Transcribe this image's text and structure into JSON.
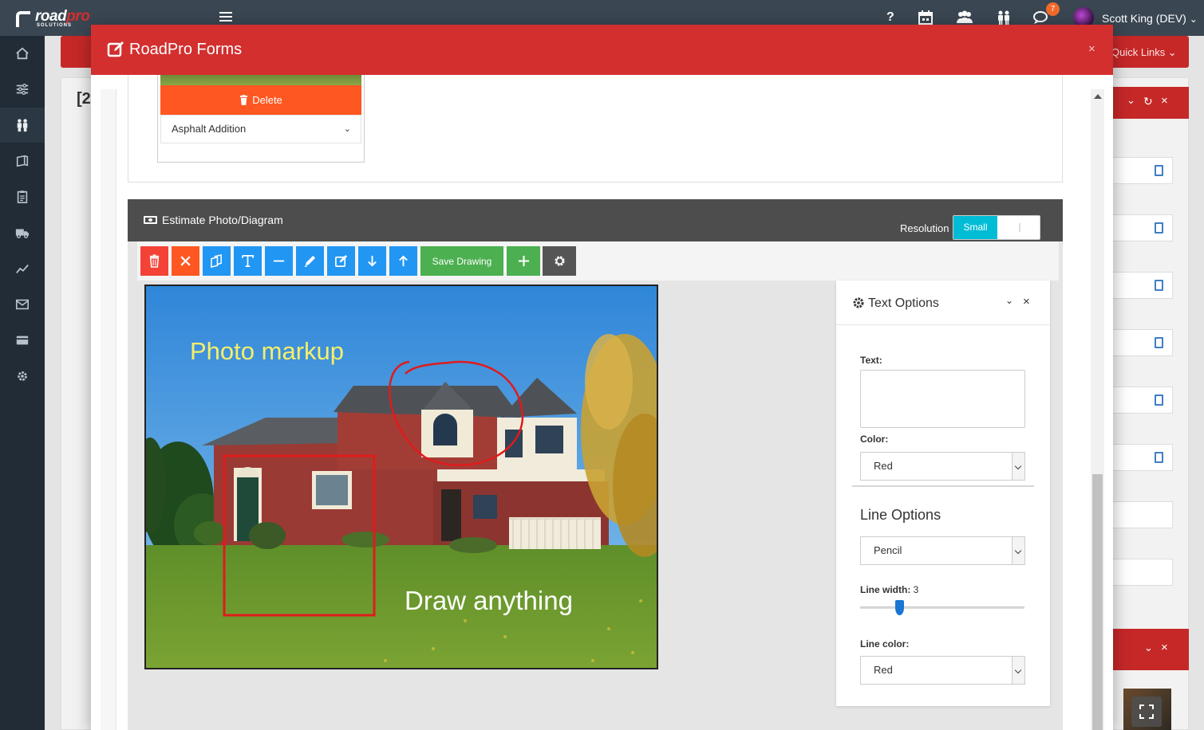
{
  "topbar": {
    "logo_primary": "road",
    "logo_accent": "pro",
    "logo_sub": "SOLUTIONS",
    "help_glyph": "?",
    "notification_count": "7",
    "user_name": "Scott King (DEV)",
    "user_chevron": "⌄"
  },
  "background": {
    "header_fragment": "[2",
    "quick_links": "Quick Links ⌄"
  },
  "modal": {
    "title": "RoadPro Forms",
    "close": "×"
  },
  "upper_card": {
    "delete_label": "Delete",
    "category_value": "Asphalt Addition"
  },
  "estimate": {
    "title": "Estimate Photo/Diagram",
    "resolution_label": "Resolution",
    "resolution_value": "Small"
  },
  "toolbar": {
    "save_label": "Save Drawing",
    "colors": {
      "danger": "#f44336",
      "warning": "#ff5722",
      "primary": "#2196f3",
      "success": "#4caf50",
      "dark": "#555555"
    }
  },
  "canvas": {
    "text_1": "Photo markup",
    "text_2": "Draw anything",
    "text_1_color": "#f5ef6a",
    "text_2_color": "#ffffff",
    "stroke_color": "#e01b1b"
  },
  "text_options": {
    "title": "Text Options",
    "text_label": "Text:",
    "text_value": "",
    "color_label": "Color:",
    "color_value": "Red",
    "line_section": "Line Options",
    "line_tool": "Pencil",
    "line_width_label": "Line width:",
    "line_width_value": "3",
    "line_color_label": "Line color:",
    "line_color_value": "Red"
  },
  "icons": [
    "home-icon",
    "sliders-icon",
    "people-icon",
    "book-icon",
    "clipboard-icon",
    "truck-icon",
    "chart-icon",
    "mail-icon",
    "card-icon",
    "gear-icon",
    "trash-icon",
    "close-icon",
    "copy-icon",
    "text-icon",
    "line-icon",
    "pencil-icon",
    "edit-icon",
    "arrow-down-icon",
    "arrow-up-icon",
    "plus-icon"
  ]
}
